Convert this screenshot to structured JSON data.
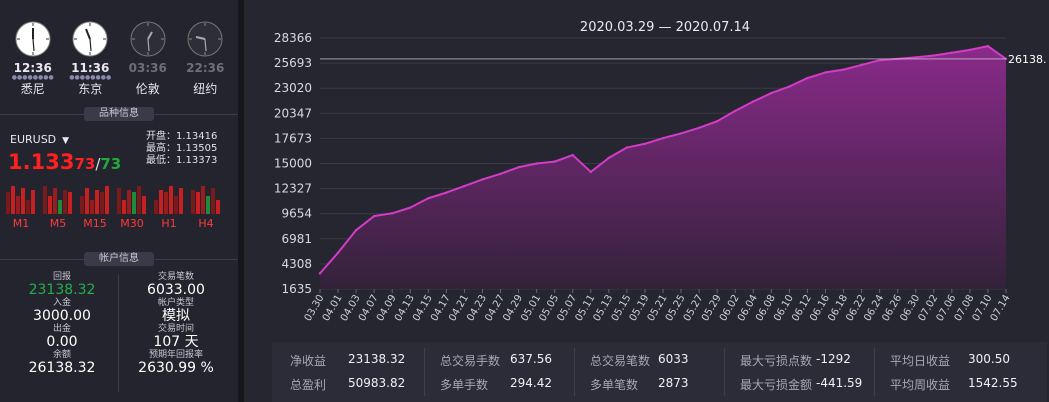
{
  "clocks": [
    {
      "time": "12:36",
      "city": "悉尼",
      "active": true
    },
    {
      "time": "11:36",
      "city": "东京",
      "active": true
    },
    {
      "time": "03:36",
      "city": "伦敦",
      "active": false
    },
    {
      "time": "22:36",
      "city": "纽约",
      "active": false
    }
  ],
  "symbol_section": {
    "title": "品种信息",
    "symbol": "EURUSD",
    "price_main": "1.133",
    "price_bid_tail": "73",
    "slash": "/",
    "price_ask_tail": "73",
    "open": "开盘：1.13416",
    "high": "最高：1.13505",
    "low": "最低：1.13373",
    "timeframes": [
      "M1",
      "M5",
      "M15",
      "M30",
      "H1",
      "H4"
    ]
  },
  "account_section": {
    "title": "帐户信息",
    "return_label": "回报",
    "return_value": "23138.32",
    "deposit_label": "入金",
    "deposit_value": "3000.00",
    "withdraw_label": "出金",
    "withdraw_value": "0.00",
    "balance_label": "余额",
    "balance_value": "26138.32",
    "trades_label": "交易笔数",
    "trades_value": "6033.00",
    "type_label": "帐户类型",
    "type_value": "模拟",
    "days_label": "交易时间",
    "days_value": "107 天",
    "annual_label": "预期年回报率",
    "annual_value": "2630.99 %"
  },
  "chart_data": {
    "type": "area",
    "title": "2020.03.29 — 2020.07.14",
    "ylim": [
      1635,
      28366
    ],
    "yticks": [
      "28366",
      "25693",
      "23020",
      "20347",
      "17673",
      "15000",
      "12327",
      "9654",
      "6981",
      "4308",
      "1635"
    ],
    "last_value_label": "26138.",
    "x": [
      "03.30",
      "04.01",
      "04.03",
      "04.07",
      "04.09",
      "04.13",
      "04.15",
      "04.17",
      "04.21",
      "04.23",
      "04.27",
      "04.29",
      "05.01",
      "05.05",
      "05.07",
      "05.11",
      "05.13",
      "05.15",
      "05.19",
      "05.21",
      "05.25",
      "05.27",
      "05.29",
      "06.02",
      "06.04",
      "06.08",
      "06.10",
      "06.12",
      "06.16",
      "06.18",
      "06.22",
      "06.24",
      "06.26",
      "06.30",
      "07.02",
      "07.06",
      "07.08",
      "07.10",
      "07.14"
    ],
    "values": [
      3300,
      5500,
      7900,
      9400,
      9700,
      10300,
      11300,
      11900,
      12600,
      13300,
      13900,
      14600,
      15000,
      15200,
      15900,
      14100,
      15600,
      16700,
      17100,
      17700,
      18200,
      18800,
      19500,
      20600,
      21600,
      22500,
      23200,
      24100,
      24700,
      25000,
      25500,
      26000,
      26138,
      26300,
      26500,
      26800,
      27100,
      27500,
      26138
    ],
    "colors": {
      "line": "#d23cc6",
      "fill_top": "#8a2a8a",
      "fill_bottom": "#33223a",
      "ref_line": "#e6e6ee"
    }
  },
  "stats": [
    {
      "label": "净收益",
      "value": "23138.32"
    },
    {
      "label": "总盈利",
      "value": "50983.82"
    },
    {
      "label": "总交易手数",
      "value": "637.56"
    },
    {
      "label": "多单手数",
      "value": "294.42"
    },
    {
      "label": "总交易笔数",
      "value": "6033"
    },
    {
      "label": "多单笔数",
      "value": "2873"
    },
    {
      "label": "最大亏损点数",
      "value": "-1292"
    },
    {
      "label": "最大亏损金额",
      "value": "-441.59"
    },
    {
      "label": "平均日收益",
      "value": "300.50"
    },
    {
      "label": "平均周收益",
      "value": "1542.55"
    }
  ]
}
